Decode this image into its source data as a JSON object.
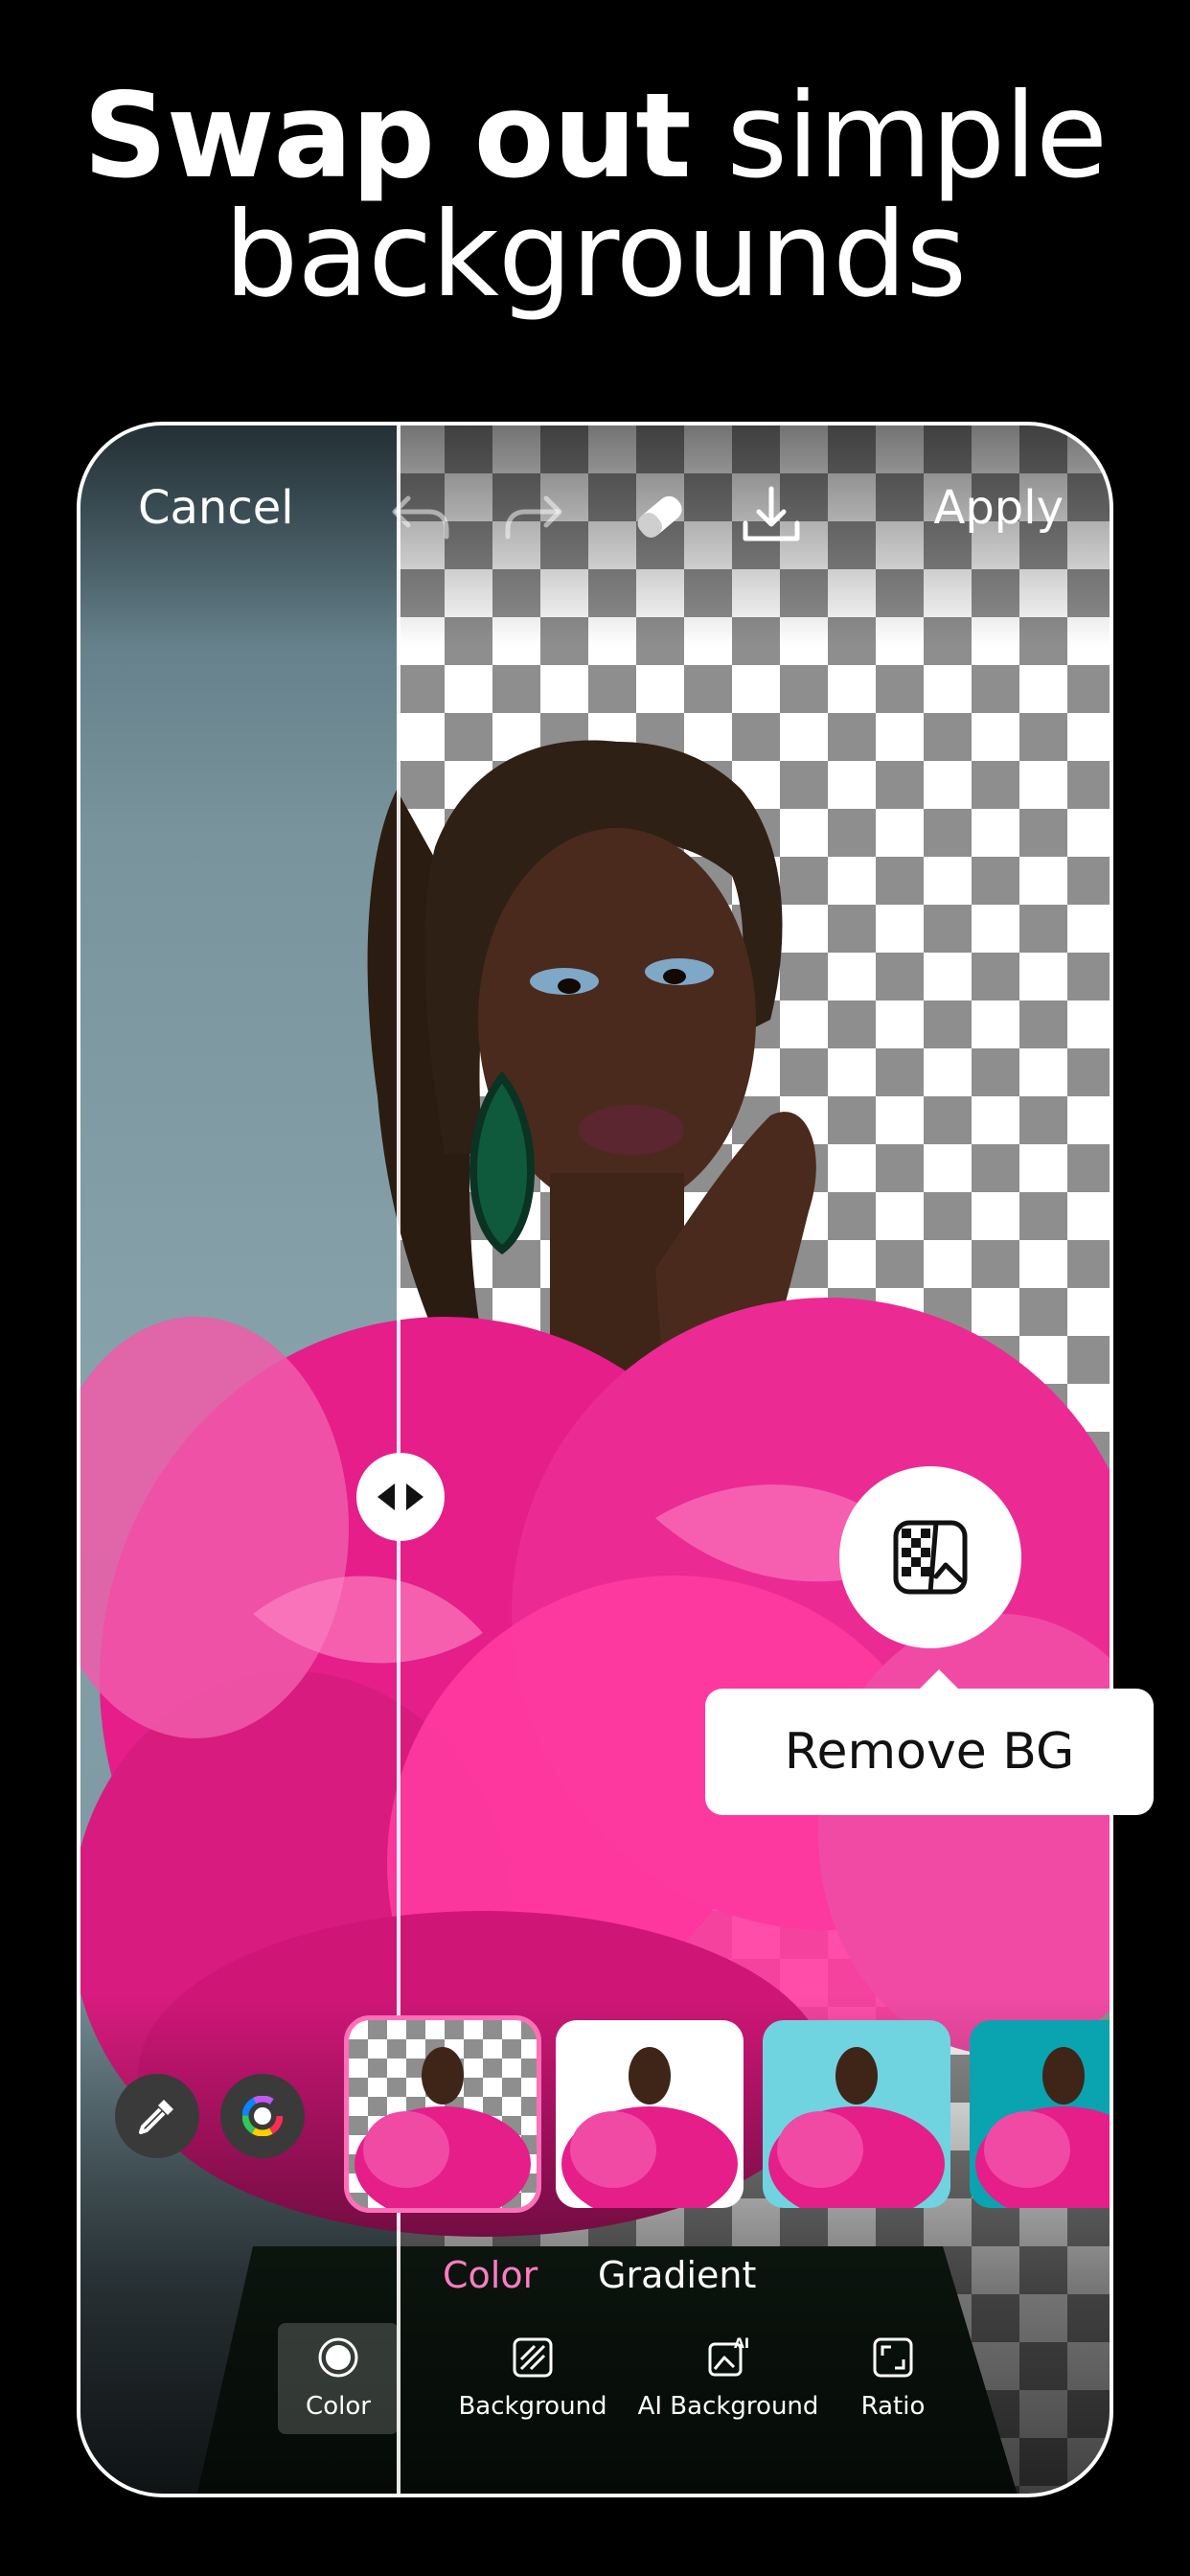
{
  "headline": {
    "bold": "Swap out",
    "normal": "simple",
    "line2": "backgrounds"
  },
  "topbar": {
    "cancel": "Cancel",
    "apply": "Apply",
    "icons": [
      "undo-icon",
      "redo-icon",
      "eraser-icon",
      "download-icon"
    ]
  },
  "compare_handle": {
    "icon": "left-right-arrows-icon"
  },
  "remove_bg": {
    "label": "Remove BG",
    "icon": "remove-bg-icon"
  },
  "tools": {
    "left": "eyedropper-icon",
    "right": "color-wheel-icon"
  },
  "thumbnails": [
    {
      "background": "transparent",
      "selected": true
    },
    {
      "background": "#ffffff",
      "selected": false
    },
    {
      "background": "#6fd4e0",
      "selected": false
    },
    {
      "background": "#0aa3b0",
      "selected": false
    }
  ],
  "segment_tabs": [
    {
      "label": "Color",
      "active": true
    },
    {
      "label": "Gradient",
      "active": false
    }
  ],
  "bottom_nav": [
    {
      "label": "Color",
      "icon": "color-icon",
      "active": true
    },
    {
      "label": "Background",
      "icon": "background-icon",
      "active": false
    },
    {
      "label": "AI Background",
      "icon": "ai-background-icon",
      "active": false
    },
    {
      "label": "Ratio",
      "icon": "ratio-icon",
      "active": false
    }
  ],
  "colors": {
    "accent": "#ff6fb8",
    "overlay": "#ffffff"
  }
}
